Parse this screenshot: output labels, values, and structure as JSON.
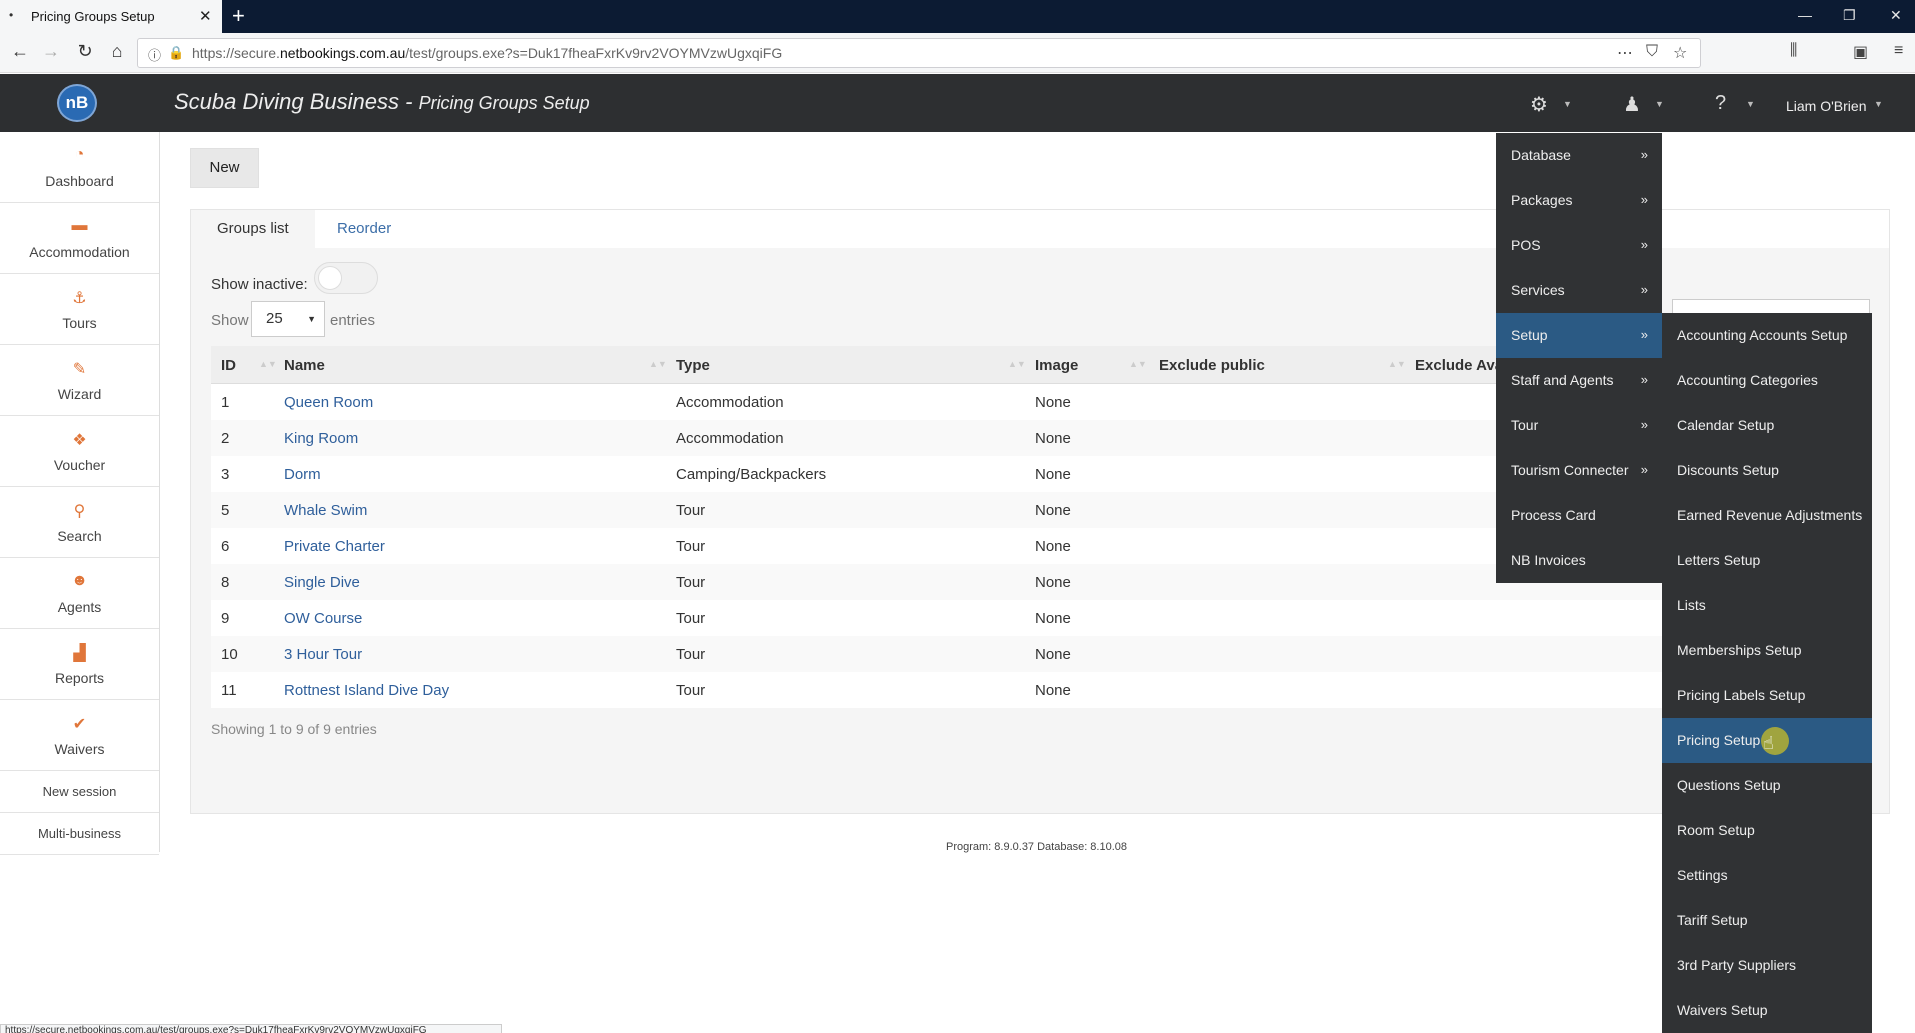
{
  "browser": {
    "tab_title": "Pricing Groups Setup",
    "tab_dot": "•",
    "tab_close": "✕",
    "new_tab": "+",
    "url_prefix": "https://secure.",
    "url_domain": "netbookings.com.au",
    "url_path": "/test/groups.exe?s=Duk17fheaFxrKv9rv2VOYMVzwUgxqiFG",
    "status_url": "https://secure.netbookings.com.au/test/groups.exe?s=Duk17fheaFxrKv9rv2VOYMVzwUgxqiFG"
  },
  "header": {
    "logo_text": "nB",
    "business": "Scuba Diving Business - ",
    "page": "Pricing Groups Setup",
    "user": "Liam O'Brien"
  },
  "sidebar": {
    "items": [
      {
        "label": "Dashboard",
        "icon": "◔"
      },
      {
        "label": "Accommodation",
        "icon": "▬"
      },
      {
        "label": "Tours",
        "icon": "⚓"
      },
      {
        "label": "Wizard",
        "icon": "✎"
      },
      {
        "label": "Voucher",
        "icon": "❖"
      },
      {
        "label": "Search",
        "icon": "⚲"
      },
      {
        "label": "Agents",
        "icon": "☻"
      },
      {
        "label": "Reports",
        "icon": "▟"
      },
      {
        "label": "Waivers",
        "icon": "✔"
      }
    ],
    "new_session": "New session",
    "multi_business": "Multi-business"
  },
  "main": {
    "new_button": "New",
    "tabs": [
      "Groups list",
      "Reorder"
    ],
    "show_inactive": "Show inactive:",
    "show": "Show",
    "page_size": "25",
    "entries": "entries",
    "columns": [
      "ID",
      "Name",
      "Type",
      "Image",
      "Exclude public",
      "Exclude Ava"
    ],
    "rows": [
      {
        "id": "1",
        "name": "Queen Room",
        "type": "Accommodation",
        "image": "None"
      },
      {
        "id": "2",
        "name": "King Room",
        "type": "Accommodation",
        "image": "None"
      },
      {
        "id": "3",
        "name": "Dorm",
        "type": "Camping/Backpackers",
        "image": "None"
      },
      {
        "id": "5",
        "name": "Whale Swim",
        "type": "Tour",
        "image": "None"
      },
      {
        "id": "6",
        "name": "Private Charter",
        "type": "Tour",
        "image": "None"
      },
      {
        "id": "8",
        "name": "Single Dive",
        "type": "Tour",
        "image": "None"
      },
      {
        "id": "9",
        "name": "OW Course",
        "type": "Tour",
        "image": "None"
      },
      {
        "id": "10",
        "name": "3 Hour Tour",
        "type": "Tour",
        "image": "None"
      },
      {
        "id": "11",
        "name": "Rottnest Island Dive Day",
        "type": "Tour",
        "image": "None"
      }
    ],
    "showing": "Showing 1 to 9 of 9 entries"
  },
  "footer": "Program: 8.9.0.37 Database: 8.10.08",
  "menu_main": [
    {
      "label": "Database",
      "arrow": "»"
    },
    {
      "label": "Packages",
      "arrow": "»"
    },
    {
      "label": "POS",
      "arrow": "»"
    },
    {
      "label": "Services",
      "arrow": "»"
    },
    {
      "label": "Setup",
      "arrow": "»"
    },
    {
      "label": "Staff and Agents",
      "arrow": "»"
    },
    {
      "label": "Tour",
      "arrow": "»"
    },
    {
      "label": "Tourism Connecter",
      "arrow": "»"
    },
    {
      "label": "Process Card",
      "arrow": ""
    },
    {
      "label": "NB Invoices",
      "arrow": ""
    }
  ],
  "menu_setup": [
    "Accounting Accounts Setup",
    "Accounting Categories",
    "Calendar Setup",
    "Discounts Setup",
    "Earned Revenue Adjustments",
    "Letters Setup",
    "Lists",
    "Memberships Setup",
    "Pricing Labels Setup",
    "Pricing Setup",
    "Questions Setup",
    "Room Setup",
    "Settings",
    "Tariff Setup",
    "3rd Party Suppliers",
    "Waivers Setup"
  ],
  "colors": {
    "accent": "#2b5a84",
    "sidebar_icon": "#e0763a",
    "link": "#2f5f9b"
  }
}
